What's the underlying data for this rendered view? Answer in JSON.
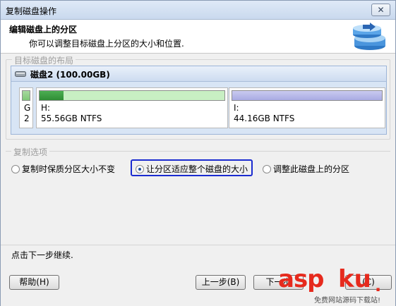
{
  "window": {
    "title": "复制磁盘操作",
    "close_label": "✕"
  },
  "header": {
    "title": "编辑磁盘上的分区",
    "subtitle": "你可以调整目标磁盘上分区的大小和位置."
  },
  "layout_group": {
    "legend": "目标磁盘的布局",
    "disk": {
      "label": "磁盘2 (100.00GB)",
      "partitions": [
        {
          "letter": "G",
          "info": "2"
        },
        {
          "letter": "H:",
          "info": "55.56GB NTFS",
          "used_fraction": 0.13
        },
        {
          "letter": "I:",
          "info": "44.16GB NTFS"
        }
      ]
    }
  },
  "copy_options": {
    "legend": "复制选项",
    "options": [
      {
        "label": "复制时保质分区大小不变",
        "selected": false
      },
      {
        "label": "让分区适应整个磁盘的大小",
        "selected": true
      },
      {
        "label": "调整此磁盘上的分区",
        "selected": false
      }
    ]
  },
  "status": {
    "text": "点击下一步继续."
  },
  "buttons": {
    "help": "帮助(H)",
    "back": "上一步(B)",
    "next": "下一步",
    "cancel": "(C)"
  },
  "watermark": {
    "brand_left": "asp",
    "brand_right": "ku",
    "brand_suffix": ".",
    "tagline": "免费网站源码下载站!"
  },
  "colors": {
    "accent": "#1a2bd0",
    "watermark": "#e62a1d",
    "used_bar": "#2f8d35"
  }
}
